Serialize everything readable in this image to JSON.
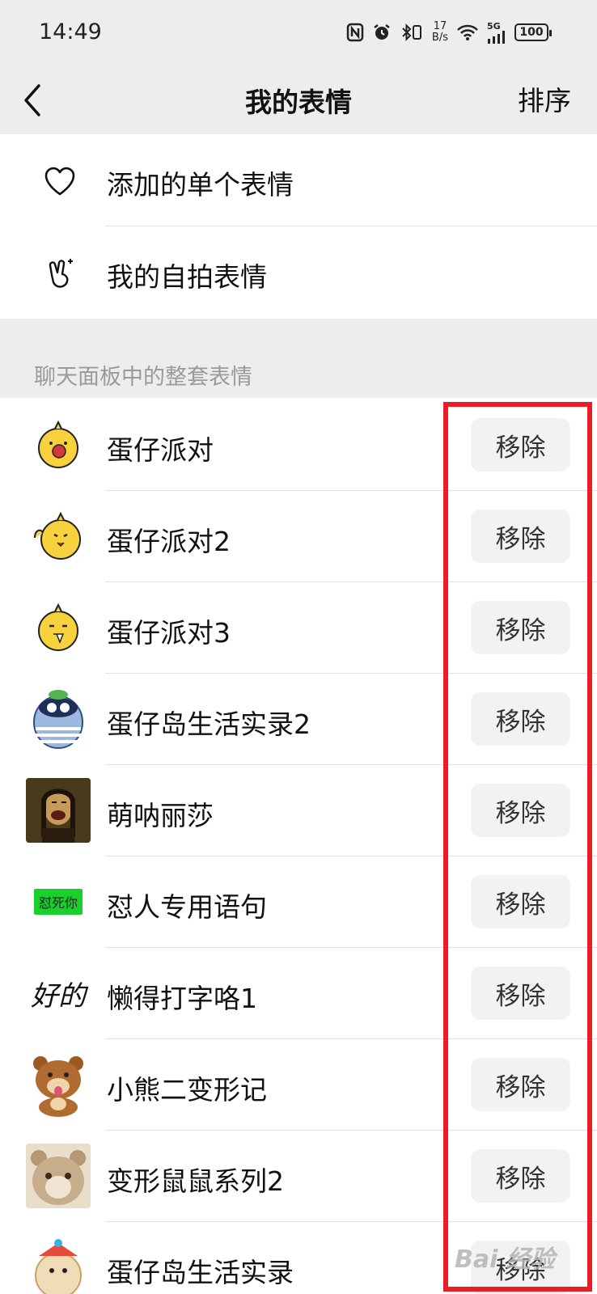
{
  "status_bar": {
    "time": "14:49",
    "net_speed_value": "17",
    "net_speed_unit": "B/s",
    "signal_label": "5G",
    "battery": "100"
  },
  "nav": {
    "title": "我的表情",
    "action_label": "排序"
  },
  "top_rows": [
    {
      "label": "添加的单个表情",
      "icon": "heart-icon"
    },
    {
      "label": "我的自拍表情",
      "icon": "selfie-hand-icon"
    }
  ],
  "section_header": "聊天面板中的整套表情",
  "remove_label": "移除",
  "sticker_packs": [
    {
      "name": "蛋仔派对",
      "thumb": "yellow-chick-sticker"
    },
    {
      "name": "蛋仔派对2",
      "thumb": "yellow-chick-wave-sticker"
    },
    {
      "name": "蛋仔派对3",
      "thumb": "yellow-chick-crying-sticker"
    },
    {
      "name": "蛋仔岛生活实录2",
      "thumb": "striped-eggy-sticker"
    },
    {
      "name": "萌呐丽莎",
      "thumb": "mona-lisa-laugh-sticker"
    },
    {
      "name": "怼人专用语句",
      "thumb": "green-text-tag",
      "thumb_text": "怼死你"
    },
    {
      "name": "懒得打字咯1",
      "thumb": "handwriting-text",
      "thumb_text": "好的"
    },
    {
      "name": "小熊二变形记",
      "thumb": "bear-sticker"
    },
    {
      "name": "变形鼠鼠系列2",
      "thumb": "hamster-sticker"
    },
    {
      "name": "蛋仔岛生活实录",
      "thumb": "eggy-hat-sticker"
    }
  ],
  "watermark": "Bai 经验",
  "colors": {
    "highlight": "#ec1c24",
    "background": "#ededed",
    "button_bg": "#f2f2f2",
    "tag_green": "#1ad12c"
  }
}
